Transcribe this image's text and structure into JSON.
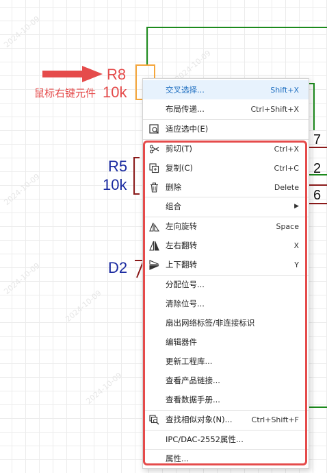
{
  "annotation": {
    "note": "鼠标右键元件"
  },
  "components": [
    {
      "ref": "R8",
      "value": "10k"
    },
    {
      "ref": "R5",
      "value": "10k"
    },
    {
      "ref": "D2"
    }
  ],
  "pins": [
    "7",
    "2",
    "6"
  ],
  "watermark": "2024-10-09",
  "colors": {
    "wire": "#1c8a1c",
    "highlight_text": "#1f6fc1",
    "annotation": "#e54b4b",
    "ref_blue": "#1a2aa0"
  },
  "menu": {
    "items": [
      {
        "label": "交叉选择...",
        "shortcut": "Shift+X",
        "icon": ""
      },
      {
        "label": "布局传递...",
        "shortcut": "Ctrl+Shift+X",
        "icon": ""
      },
      {
        "label": "适应选中(E)",
        "shortcut": "",
        "icon": "zoom-fit-icon"
      },
      {
        "label": "剪切(T)",
        "shortcut": "Ctrl+X",
        "icon": "scissors-icon"
      },
      {
        "label": "复制(C)",
        "shortcut": "Ctrl+C",
        "icon": "copy-icon"
      },
      {
        "label": "删除",
        "shortcut": "Delete",
        "icon": "trash-icon"
      },
      {
        "label": "组合",
        "shortcut": "",
        "icon": "",
        "submenu": true
      },
      {
        "label": "左向旋转",
        "shortcut": "Space",
        "icon": "rotate-left-icon"
      },
      {
        "label": "左右翻转",
        "shortcut": "X",
        "icon": "flip-horizontal-icon"
      },
      {
        "label": "上下翻转",
        "shortcut": "Y",
        "icon": "flip-vertical-icon"
      },
      {
        "label": "分配位号...",
        "shortcut": "",
        "icon": ""
      },
      {
        "label": "清除位号...",
        "shortcut": "",
        "icon": ""
      },
      {
        "label": "扇出网络标签/非连接标识",
        "shortcut": "",
        "icon": ""
      },
      {
        "label": "编辑器件",
        "shortcut": "",
        "icon": ""
      },
      {
        "label": "更新工程库...",
        "shortcut": "",
        "icon": ""
      },
      {
        "label": "查看产品链接...",
        "shortcut": "",
        "icon": ""
      },
      {
        "label": "查看数据手册...",
        "shortcut": "",
        "icon": ""
      },
      {
        "label": "查找相似对象(N)...",
        "shortcut": "Ctrl+Shift+F",
        "icon": "find-similar-icon"
      },
      {
        "label": "IPC/DAC-2552属性...",
        "shortcut": "",
        "icon": ""
      },
      {
        "label": "属性...",
        "shortcut": "",
        "icon": ""
      }
    ]
  }
}
